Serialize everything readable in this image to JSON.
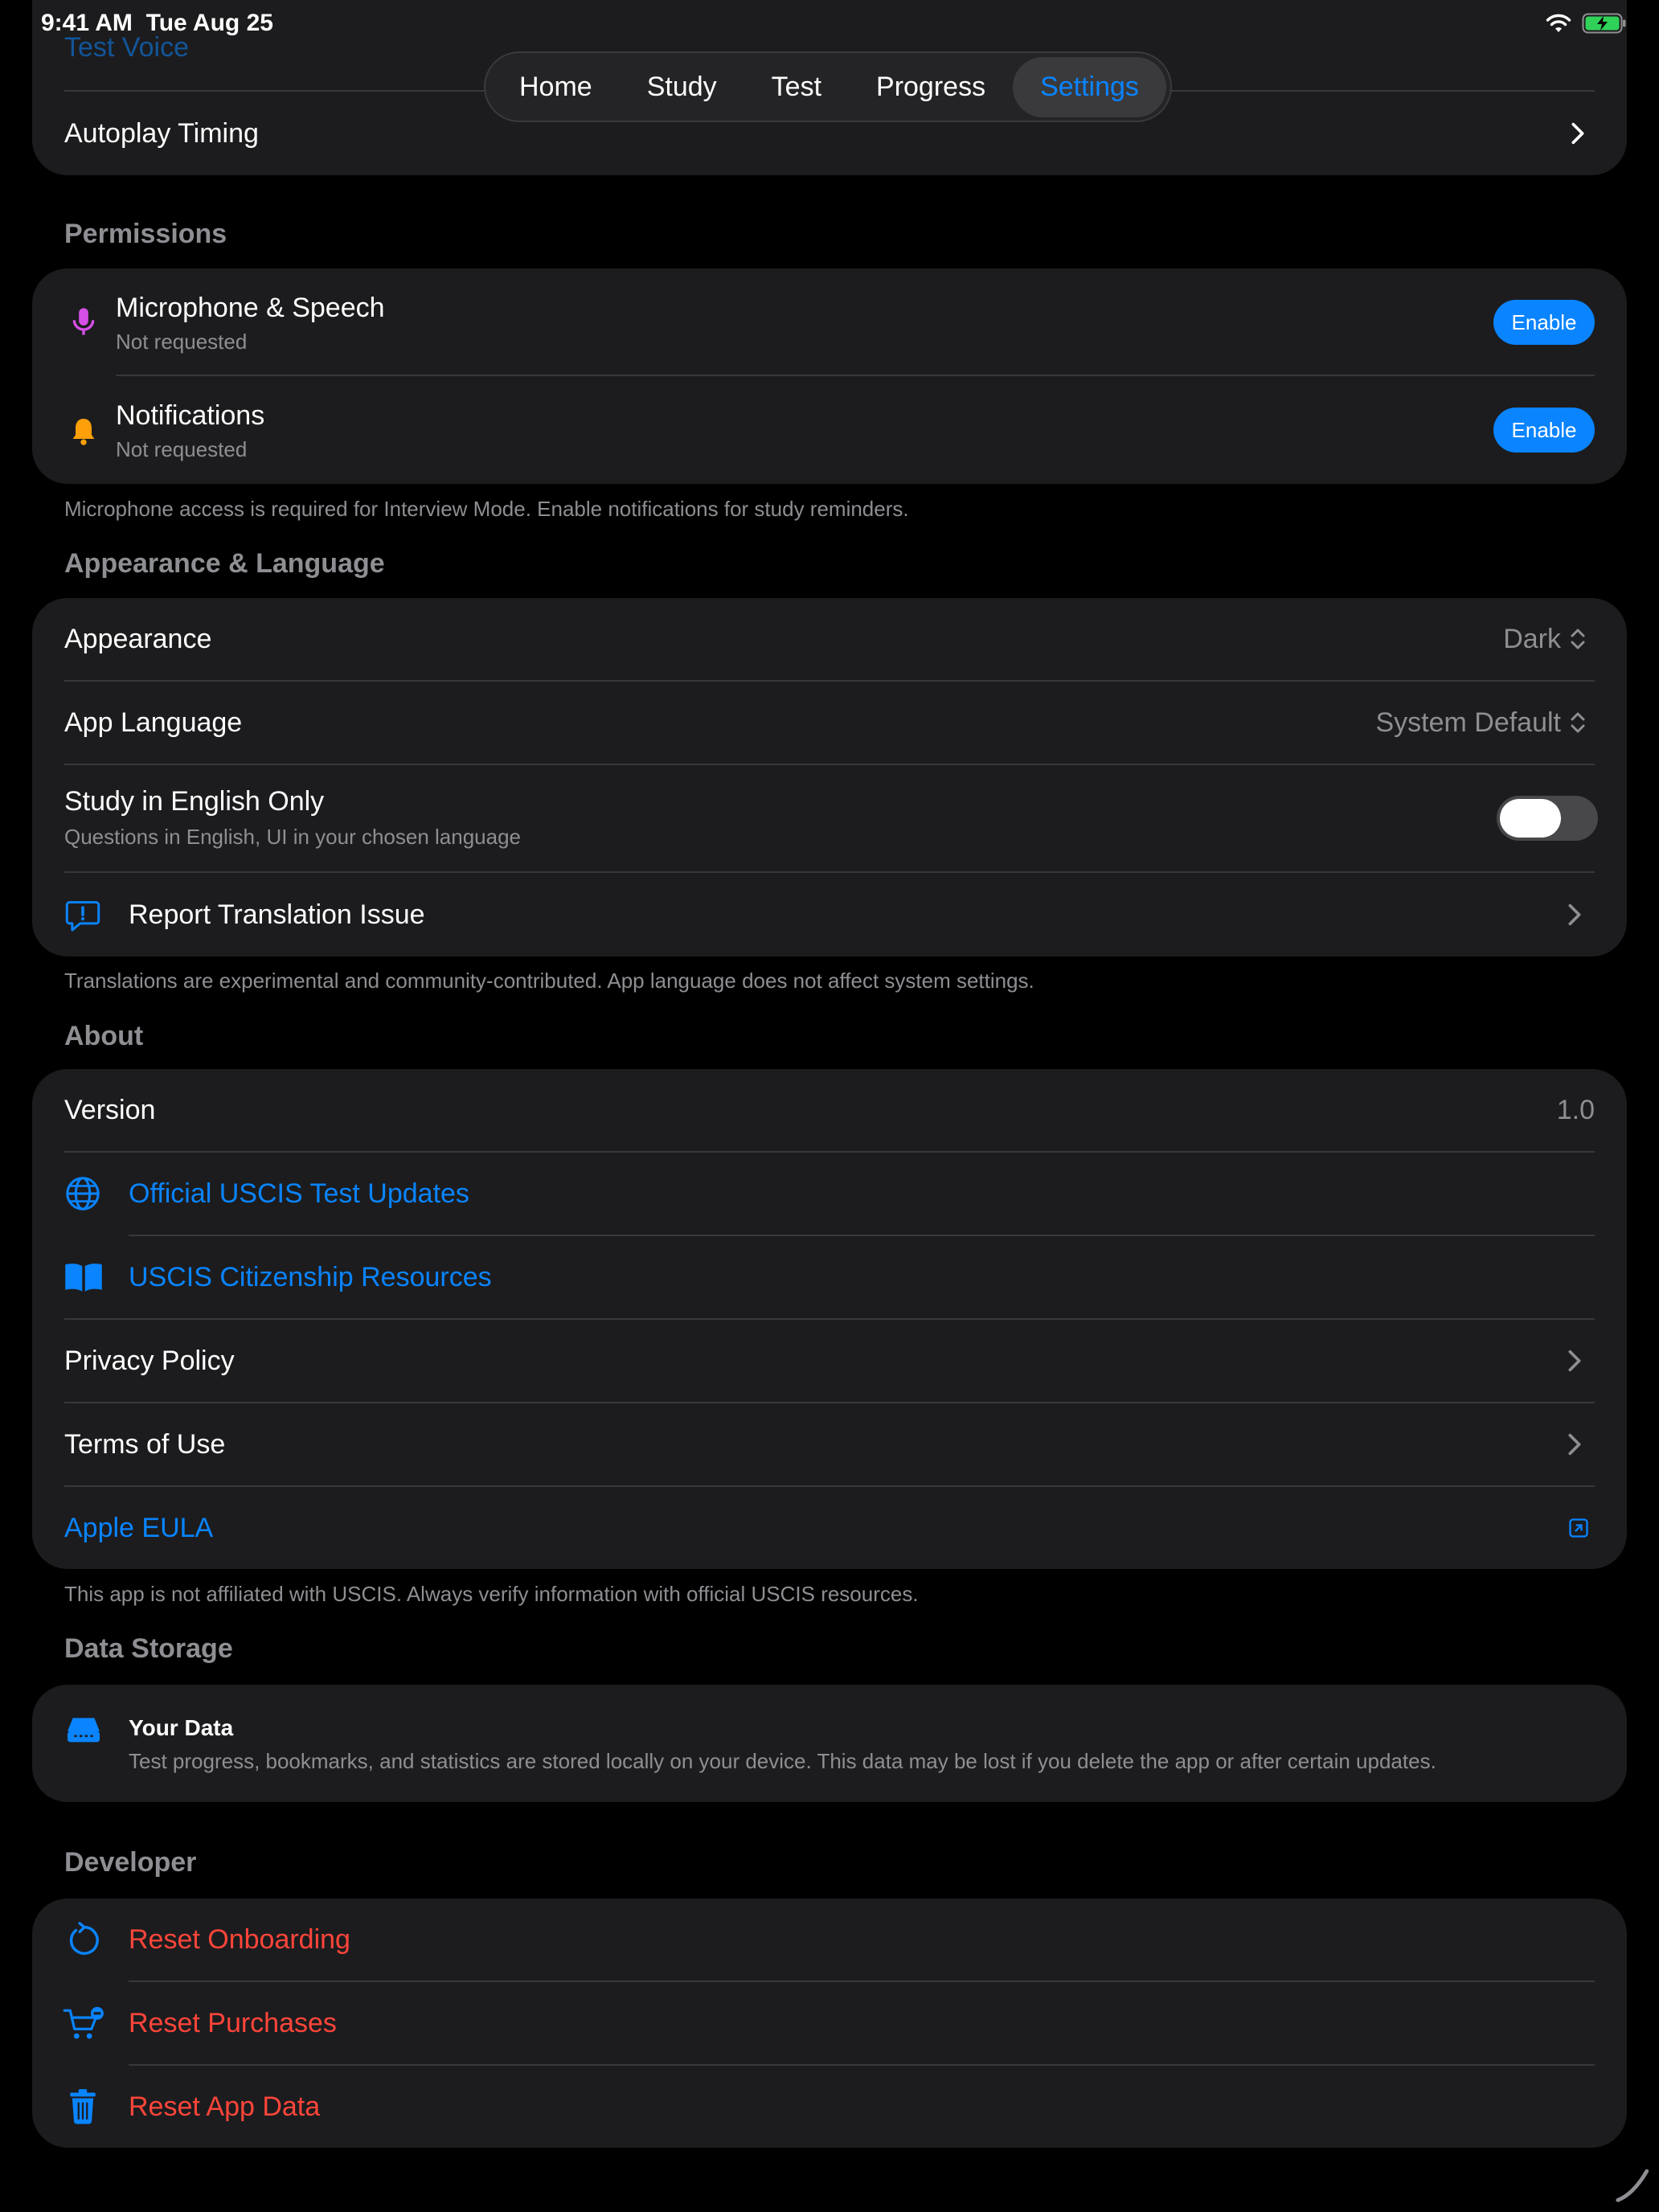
{
  "status_bar": {
    "time": "9:41 AM",
    "date": "Tue Aug 25",
    "battery_level": 1.0,
    "icons": [
      "wifi-icon",
      "battery-charging-icon"
    ]
  },
  "tabs": [
    {
      "label": "Home",
      "active": false
    },
    {
      "label": "Study",
      "active": false
    },
    {
      "label": "Test",
      "active": false
    },
    {
      "label": "Progress",
      "active": false
    },
    {
      "label": "Settings",
      "active": true
    }
  ],
  "voice_card": {
    "test_voice": "Test Voice",
    "autoplay_timing": "Autoplay Timing"
  },
  "permissions": {
    "title": "Permissions",
    "items": [
      {
        "icon": "microphone-icon",
        "label": "Microphone & Speech",
        "status": "Not requested",
        "button": "Enable"
      },
      {
        "icon": "bell-icon",
        "label": "Notifications",
        "status": "Not requested",
        "button": "Enable"
      }
    ],
    "footer": "Microphone access is required for Interview Mode. Enable notifications for study reminders."
  },
  "appearance": {
    "title": "Appearance & Language",
    "appearance_label": "Appearance",
    "appearance_value": "Dark",
    "language_label": "App Language",
    "language_value": "System Default",
    "english_only_label": "Study in English Only",
    "english_only_sub": "Questions in English, UI in your chosen language",
    "english_only_on": false,
    "report_label": "Report Translation Issue",
    "footer": "Translations are experimental and community-contributed. App language does not affect system settings."
  },
  "about": {
    "title": "About",
    "version_label": "Version",
    "version_value": "1.0",
    "official_updates": "Official USCIS Test Updates",
    "resources": "USCIS Citizenship Resources",
    "privacy": "Privacy Policy",
    "terms": "Terms of Use",
    "eula": "Apple EULA",
    "footer": "This app is not affiliated with USCIS. Always verify information with official USCIS resources."
  },
  "data_storage": {
    "title": "Data Storage",
    "your_data_title": "Your Data",
    "your_data_desc": "Test progress, bookmarks, and statistics are stored locally on your device. This data may be lost if you delete the app or after certain updates."
  },
  "developer": {
    "title": "Developer",
    "reset_onboarding": "Reset Onboarding",
    "reset_purchases": "Reset Purchases",
    "reset_app_data": "Reset App Data"
  },
  "colors": {
    "accent": "#0a84ff",
    "destructive": "#ff453a",
    "card": "#1c1c1e",
    "background": "#000000",
    "mic": "#d64fe6",
    "bell": "#ff9f0a"
  }
}
